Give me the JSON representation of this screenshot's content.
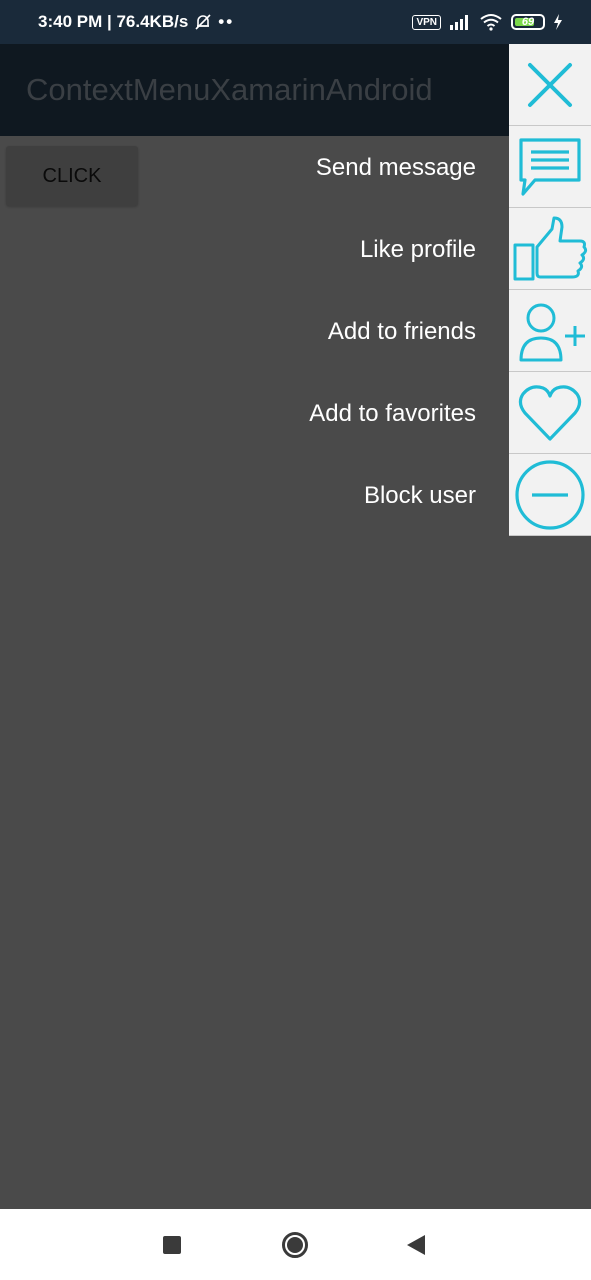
{
  "status_bar": {
    "time_speed": "3:40 PM | 76.4KB/s",
    "vpn": "VPN",
    "battery": "69"
  },
  "toolbar": {
    "title": "ContextMenuXamarinAndroid"
  },
  "main": {
    "click_label": "CLICK"
  },
  "context_menu": {
    "items": [
      {
        "label": "Send message",
        "icon": "chat-bubble-icon"
      },
      {
        "label": "Like profile",
        "icon": "thumbs-up-icon"
      },
      {
        "label": "Add to friends",
        "icon": "add-user-icon"
      },
      {
        "label": "Add to favorites",
        "icon": "heart-icon"
      },
      {
        "label": "Block user",
        "icon": "minus-circle-icon"
      }
    ],
    "close_icon": "close-icon",
    "accent_color": "#20bcd6"
  },
  "nav_bar": {
    "recents_icon": "square-icon",
    "home_icon": "circle-icon",
    "back_icon": "triangle-back-icon"
  }
}
